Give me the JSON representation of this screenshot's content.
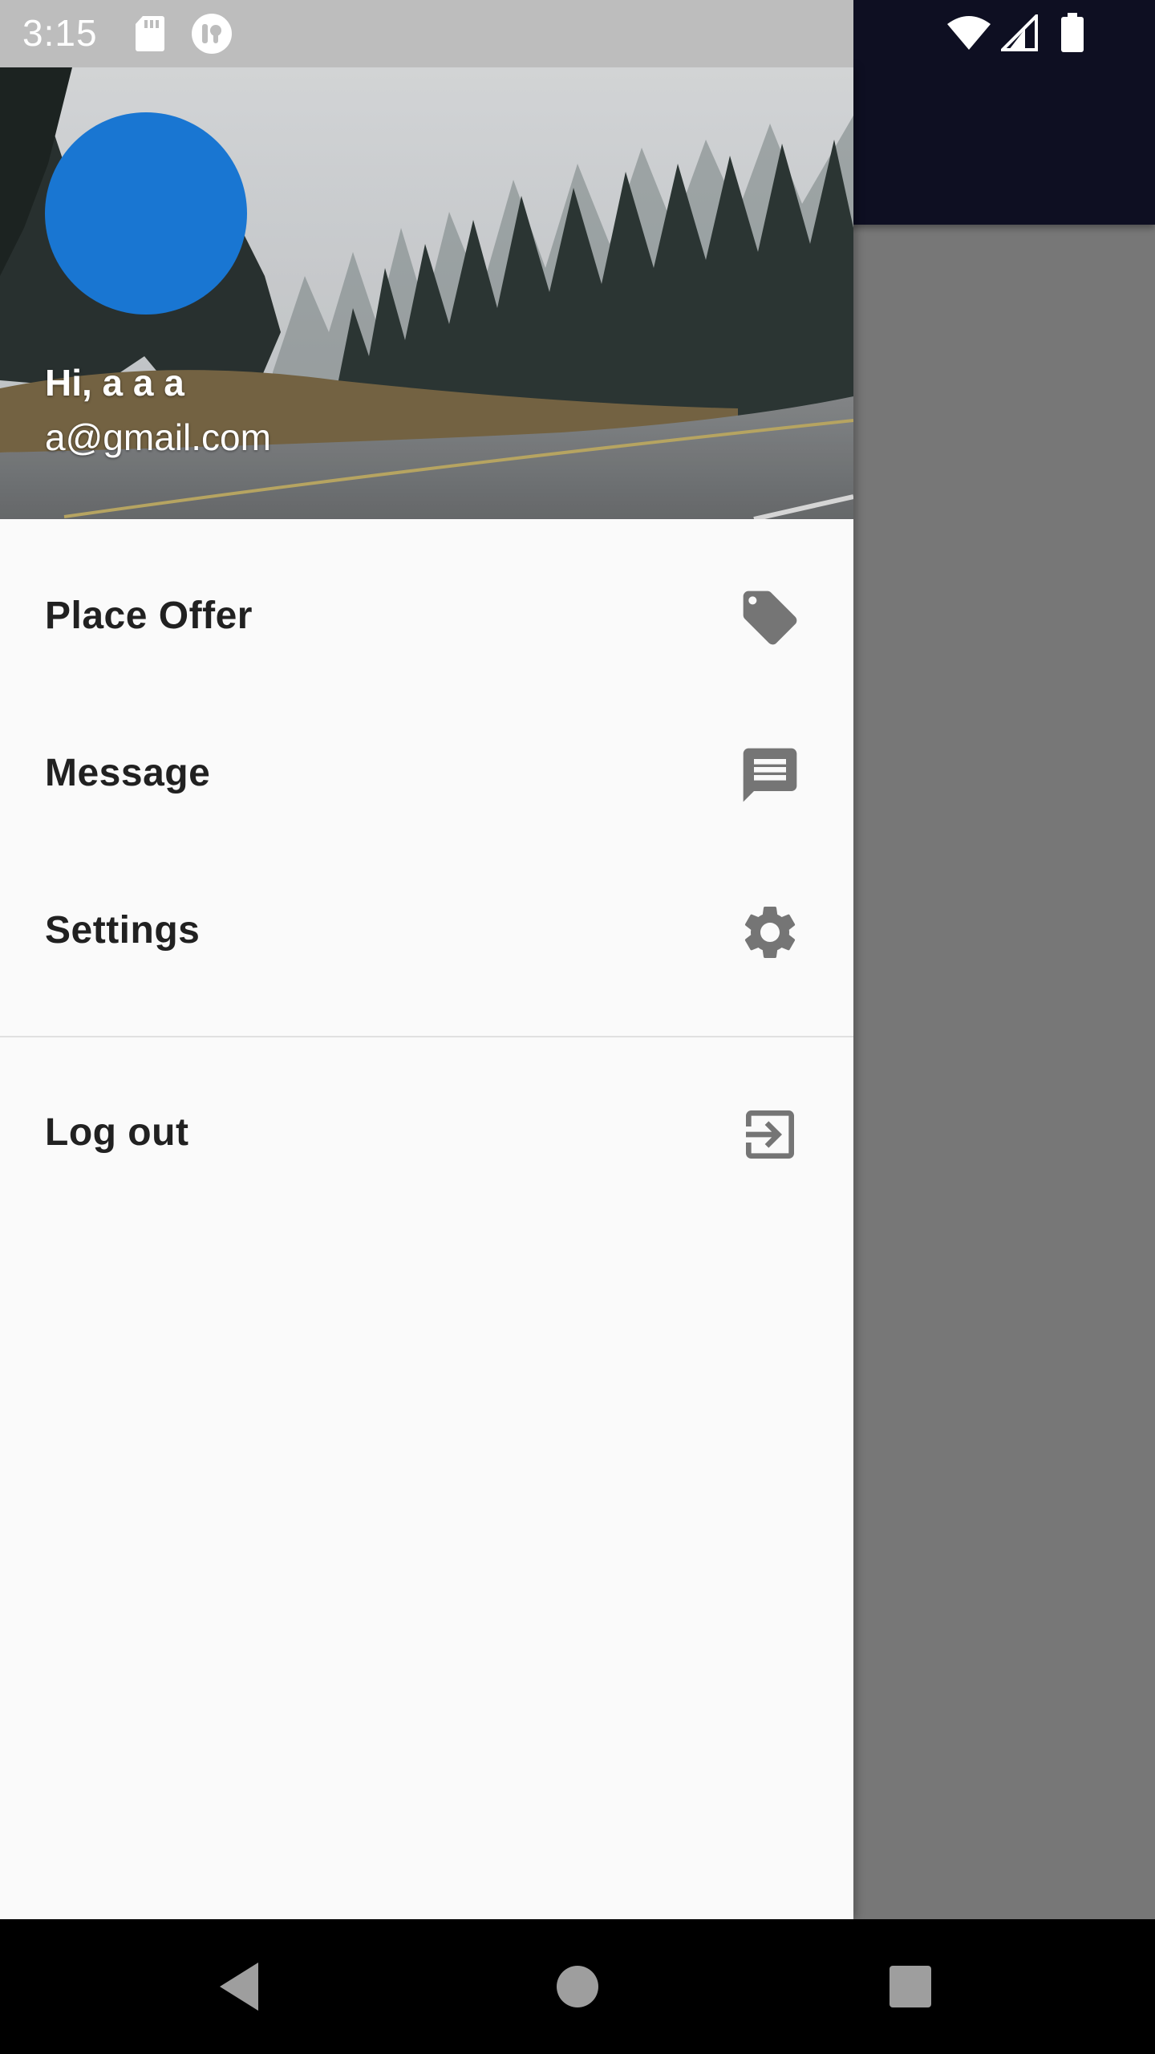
{
  "status_bar": {
    "time": "3:15"
  },
  "drawer": {
    "header": {
      "greeting": "Hi, a a a",
      "email": "a@gmail.com"
    },
    "menu": [
      {
        "label": "Place Offer",
        "icon": "tag-icon"
      },
      {
        "label": "Message",
        "icon": "message-icon"
      },
      {
        "label": "Settings",
        "icon": "gear-icon"
      }
    ],
    "logout": {
      "label": "Log out",
      "icon": "exit-icon"
    }
  },
  "colors": {
    "avatar": "#1976d2",
    "toolbar": "#0e0f22",
    "icon": "#757575",
    "text": "#212121"
  }
}
